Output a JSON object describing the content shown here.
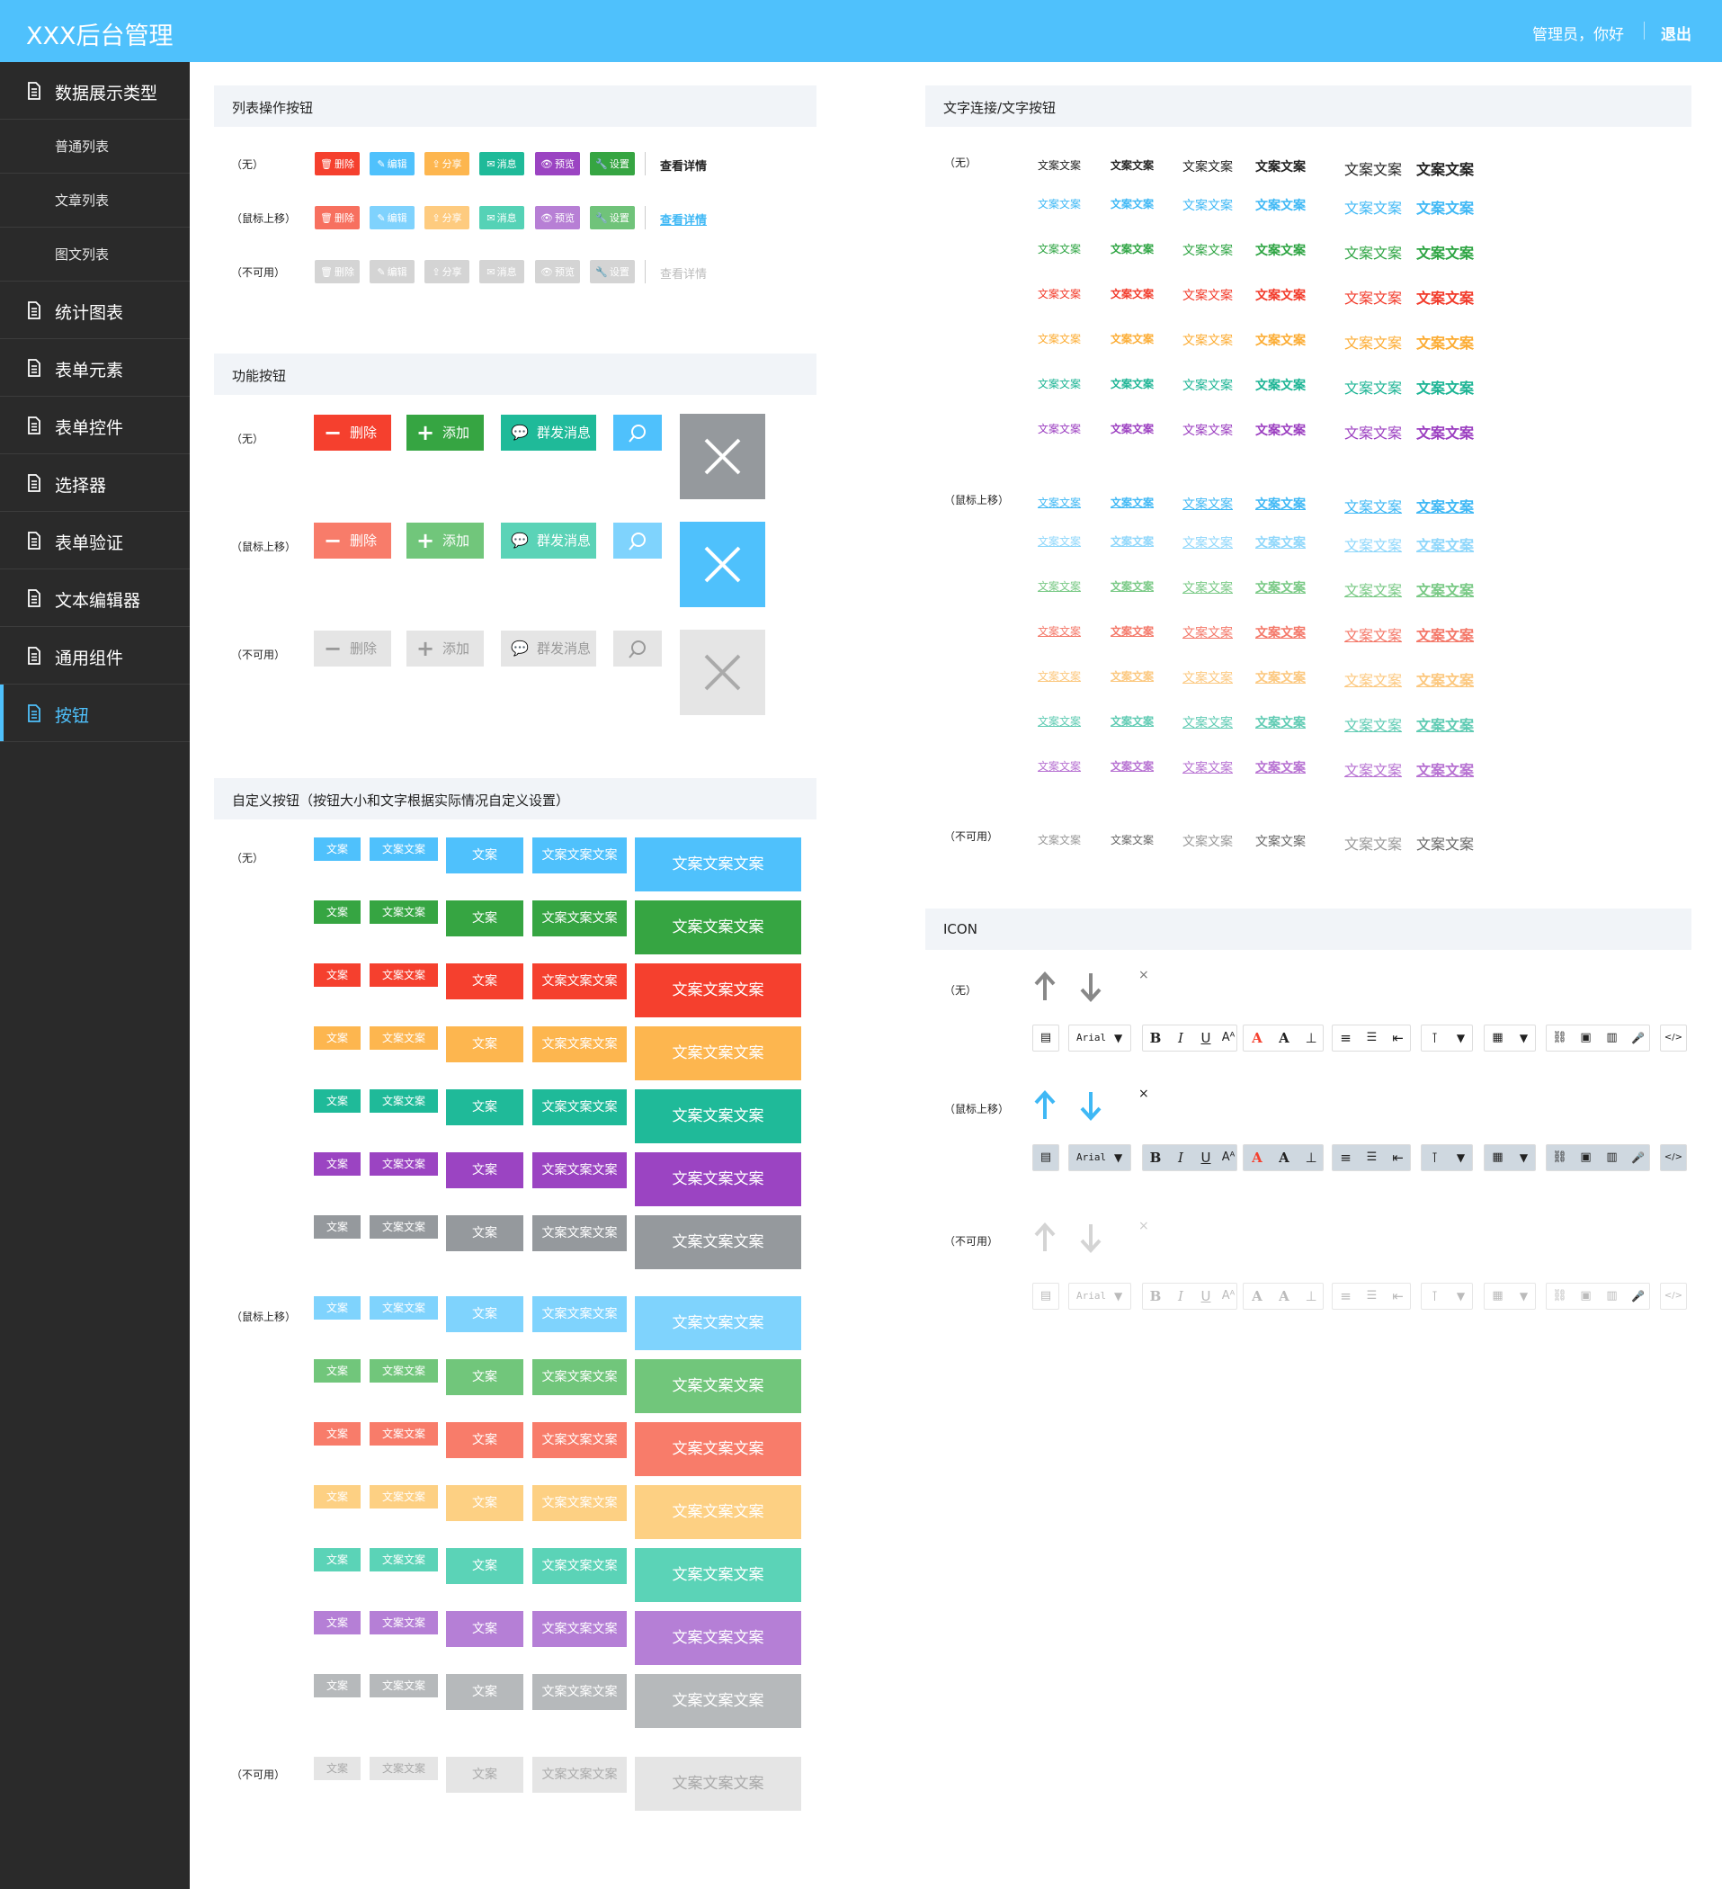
{
  "header": {
    "title": "XXX后台管理",
    "user_text": "管理员，你好",
    "logout": "退出"
  },
  "sidebar": {
    "items": [
      {
        "label": "数据展示类型",
        "type": "main"
      },
      {
        "label": "普通列表",
        "type": "sub"
      },
      {
        "label": "文章列表",
        "type": "sub"
      },
      {
        "label": "图文列表",
        "type": "sub"
      },
      {
        "label": "统计图表",
        "type": "main"
      },
      {
        "label": "表单元素",
        "type": "main"
      },
      {
        "label": "表单控件",
        "type": "main"
      },
      {
        "label": "选择器",
        "type": "main"
      },
      {
        "label": "表单验证",
        "type": "main"
      },
      {
        "label": "文本编辑器",
        "type": "main"
      },
      {
        "label": "通用组件",
        "type": "main"
      },
      {
        "label": "按钮",
        "type": "main",
        "active": true
      }
    ]
  },
  "states": {
    "none": "（无）",
    "hover": "（鼠标上移）",
    "disabled": "（不可用）"
  },
  "sections": {
    "list_ops": "列表操作按钮",
    "function": "功能按钮",
    "custom": "自定义按钮（按钮大小和文字根据实际情况自定义设置）",
    "text_links": "文字连接/文字按钮",
    "icon": "ICON"
  },
  "list_ops": {
    "buttons": [
      {
        "label": "删除",
        "glyph": "🗑",
        "color": "#f5402e",
        "hover": "#f7705f"
      },
      {
        "label": "编辑",
        "glyph": "✎",
        "color": "#4fc1fc",
        "hover": "#7fd2fd"
      },
      {
        "label": "分享",
        "glyph": "⇪",
        "color": "#fdb64f",
        "hover": "#fecb7f"
      },
      {
        "label": "消息",
        "glyph": "✉",
        "color": "#1fba99",
        "hover": "#55d2b6"
      },
      {
        "label": "预览",
        "glyph": "👁",
        "color": "#9b44c2",
        "hover": "#b77fd5"
      },
      {
        "label": "设置",
        "glyph": "🔧",
        "color": "#36a542",
        "hover": "#70c37a"
      }
    ],
    "detail_link": "查看详情",
    "disabled_color": "#d4d4d4"
  },
  "func_buttons": {
    "delete": "删除",
    "add": "添加",
    "message": "群发消息"
  },
  "custom": {
    "colors_none": [
      "#4fc1fc",
      "#36a542",
      "#f5402e",
      "#fdb64f",
      "#1fba99",
      "#9b44c2",
      "#95999d"
    ],
    "colors_hover": [
      "#7fd3fd",
      "#71c67b",
      "#f87c6a",
      "#fdd083",
      "#5bd3b7",
      "#b57fd6",
      "#b6b9bb"
    ],
    "disabled_color": "#e5e5e5",
    "labels": [
      "文案",
      "文案文案",
      "文案",
      "文案文案文案",
      "文案文案文案"
    ]
  },
  "text_links": {
    "label": "文案文案",
    "colors": [
      "#222222",
      "#3fb8f5",
      "#2da442",
      "#f23a2a",
      "#fcac33",
      "#1cb494",
      "#9b3ec0"
    ],
    "hover_colors": [
      "#3fb8f5",
      "#8fd7fb",
      "#79c985",
      "#f47869",
      "#fcc87f",
      "#5fcbb3",
      "#b772d2"
    ],
    "disabled_color": "#666666"
  },
  "icon": {
    "toolbar_font": "Arial",
    "close_glyph": "×",
    "colors": {
      "none": "#888888",
      "hover": "#3fb8f5",
      "disabled": "#d4d4d4"
    }
  }
}
